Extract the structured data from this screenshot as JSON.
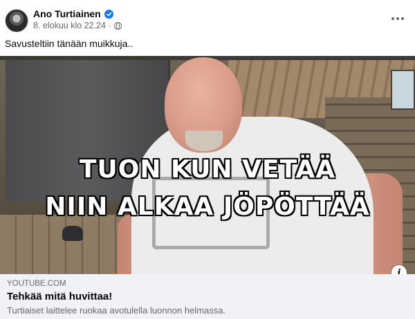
{
  "post": {
    "author": "Ano Turtiainen",
    "timestamp": "8. elokuu klo 22.24",
    "separator": "·",
    "privacy_icon": "globe-icon",
    "verified_icon": "verified-badge-icon",
    "more_icon": "more-options-icon",
    "text": "Savusteltiin tänään muikkuja.."
  },
  "video": {
    "overlay_line1": "TUON KUN VETÄÄ",
    "overlay_line2": "NIIN ALKAA JÖPÖTTÄÄ",
    "info_label": "i"
  },
  "link_preview": {
    "domain": "YOUTUBE.COM",
    "title": "Tehkää mitä huvittaa!",
    "description": "Turtiaiset laittelee ruokaa avotulella luonnon helmassa."
  },
  "colors": {
    "accent": "#1877f2",
    "secondary_text": "#65676b",
    "preview_bg": "#f0f2f5"
  }
}
